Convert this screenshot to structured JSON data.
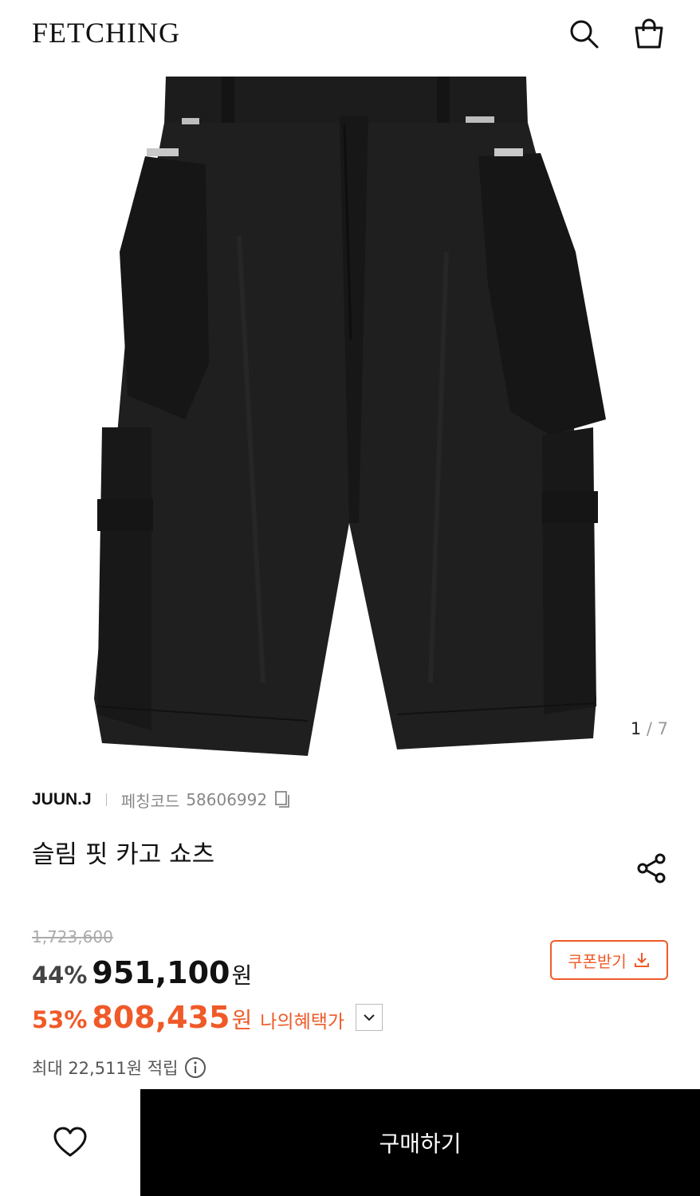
{
  "header": {
    "logo": "FETCHING",
    "icons": [
      "search-icon",
      "shopping-bag-icon"
    ]
  },
  "gallery": {
    "current": "1",
    "separator": " / ",
    "total": "7"
  },
  "product": {
    "brand": "JUUN.J",
    "code_label": "페칭코드",
    "code": "58606992",
    "title": "슬림 핏 카고 쇼츠"
  },
  "price": {
    "original": "1,723,600",
    "discount": "44%",
    "sale": "951,100",
    "currency": "원",
    "benefit_discount": "53%",
    "benefit_price": "808,435",
    "benefit_label": "나의혜택가",
    "coupon_label": "쿠폰받기",
    "points_text": "최대 22,511원 적립"
  },
  "bottom_bar": {
    "buy_label": "구매하기"
  },
  "colors": {
    "accent": "#f05a28",
    "buy_bg": "#000000"
  }
}
